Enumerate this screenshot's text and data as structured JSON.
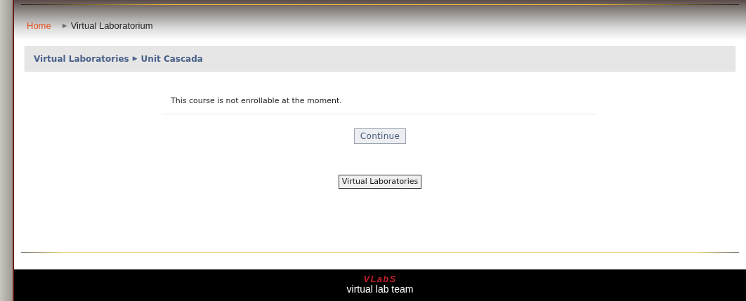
{
  "header_breadcrumb": {
    "home": "Home",
    "separator": "▶",
    "current": "Virtual Laboratorium"
  },
  "navbar": {
    "items": [
      "Virtual Laboratories",
      "Unit Cascada"
    ],
    "separator": "▶"
  },
  "message": "This course is not enrollable at the moment.",
  "buttons": [
    {
      "label": "Continue",
      "kind": "primary"
    },
    {
      "label": "Virtual Laboratories",
      "kind": "plain"
    }
  ],
  "footer": {
    "logo": "VLabS",
    "tagline": "virtual lab team"
  }
}
